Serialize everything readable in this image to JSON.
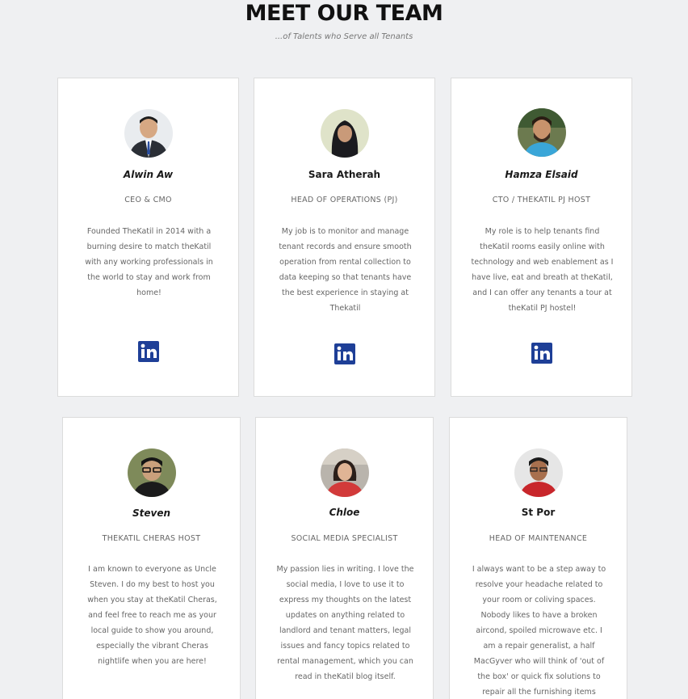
{
  "header": {
    "title": "MEET OUR TEAM",
    "subtitle": "...of Talents who Serve all Tenants"
  },
  "team": [
    {
      "name": "Alwin Aw",
      "role": "CEO & CMO",
      "bio": "Founded TheKatil in 2014 with a burning desire to match theKatil with any working professionals in the world to stay and work from home!",
      "linkedin_icon": "linkedin-icon"
    },
    {
      "name": "Sara Atherah",
      "role": "HEAD OF OPERATIONS (PJ)",
      "bio": "My job is to monitor and manage tenant records and ensure smooth operation from rental collection to data keeping so that tenants have the best experience in staying at Thekatil",
      "linkedin_icon": "linkedin-icon"
    },
    {
      "name": "Hamza Elsaid",
      "role": "CTO / THEKATIL PJ HOST",
      "bio": "My role is to help tenants find theKatil rooms easily online with technology and web enablement as I have live, eat and breath at theKatil, and I can offer any tenants a tour at theKatil PJ hostel!",
      "linkedin_icon": "linkedin-icon"
    },
    {
      "name": "Steven",
      "role": "THEKATIL CHERAS HOST",
      "bio": "I am known to everyone as Uncle Steven. I do my best to host you when you stay at theKatil Cheras, and feel free to reach me as your local guide to show you around, especially the vibrant Cheras nightlife when you are here!"
    },
    {
      "name": "Chloe",
      "role": "SOCIAL MEDIA SPECIALIST",
      "bio": "My passion lies in writing.  I love the social media, I love to use it to express my thoughts on the latest updates on anything related to landlord and tenant matters, legal issues and fancy topics related to rental management, which you can read in theKatil blog itself."
    },
    {
      "name": "St Por",
      "role": "HEAD OF MAINTENANCE",
      "bio": "I always want to be a step away to resolve your headache related to your room or coliving spaces. Nobody likes to have a broken aircond, spoiled microwave etc. I am a repair generalist, a half MacGyver who will think of 'out of the box' or quick fix solutions to repair all the furnishing items provided in your"
    }
  ],
  "colors": {
    "page_background": "#eff0f2",
    "card_background": "#ffffff",
    "linkedin_blue": "#1e3f97"
  }
}
